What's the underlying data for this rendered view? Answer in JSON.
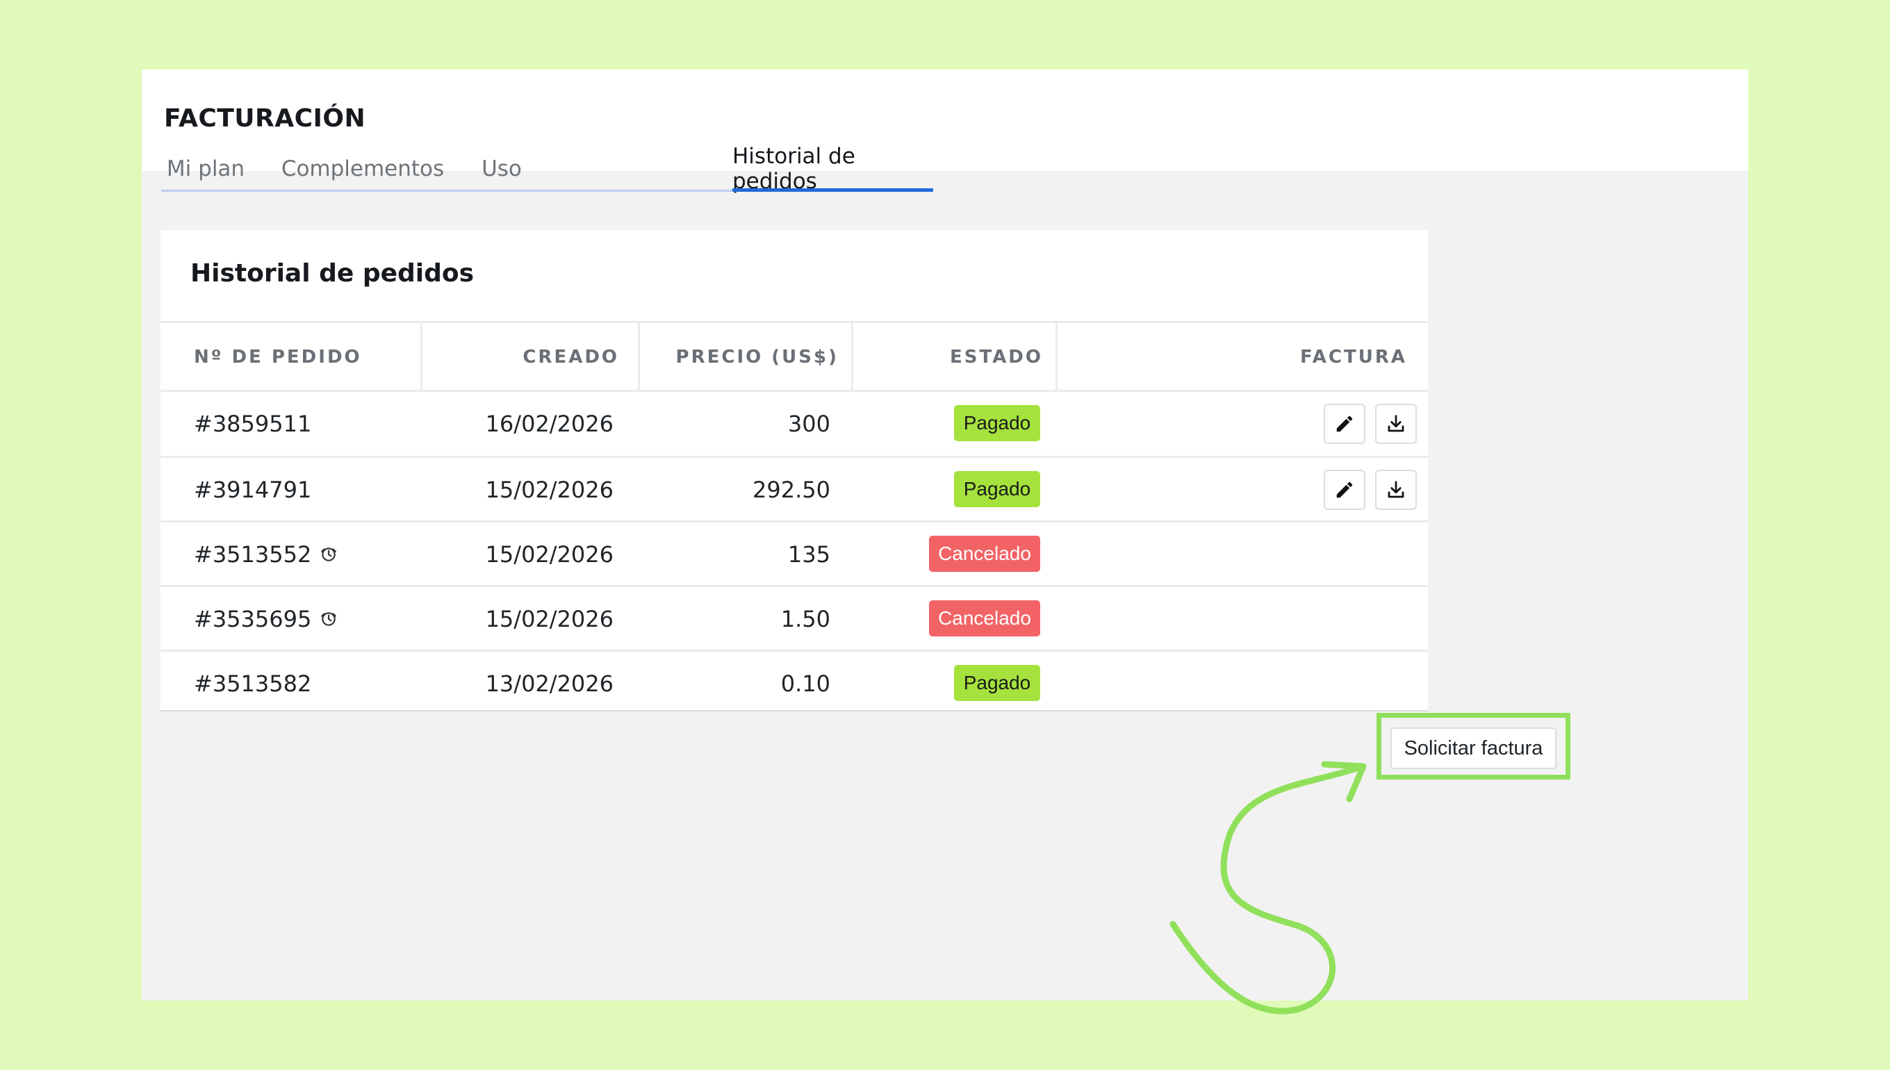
{
  "page": {
    "title": "FACTURACIÓN",
    "tabs": [
      {
        "label": "Mi plan",
        "active": false
      },
      {
        "label": "Complementos",
        "active": false
      },
      {
        "label": "Uso",
        "active": false
      },
      {
        "label": "Historial de pedidos",
        "active": true
      }
    ]
  },
  "orders": {
    "title": "Historial de pedidos",
    "columns": {
      "order": "Nº DE PEDIDO",
      "created": "CREADO",
      "price": "PRECIO (US$)",
      "status": "ESTADO",
      "invoice": "FACTURA"
    },
    "rows": [
      {
        "id": "#3859511",
        "created": "16/02/2026",
        "price": "300",
        "status": "Pagado",
        "status_type": "paid",
        "clock_icon": false,
        "invoice_actions": [
          "edit-icon",
          "download-icon"
        ]
      },
      {
        "id": "#3914791",
        "created": "15/02/2026",
        "price": "292.50",
        "status": "Pagado",
        "status_type": "paid",
        "clock_icon": false,
        "invoice_actions": [
          "edit-icon",
          "download-icon"
        ]
      },
      {
        "id": "#3513552",
        "created": "15/02/2026",
        "price": "135",
        "status": "Cancelado",
        "status_type": "cancelled",
        "clock_icon": true,
        "invoice_actions": []
      },
      {
        "id": "#3535695",
        "created": "15/02/2026",
        "price": "1.50",
        "status": "Cancelado",
        "status_type": "cancelled",
        "clock_icon": true,
        "invoice_actions": []
      },
      {
        "id": "#3513582",
        "created": "13/02/2026",
        "price": "0.10",
        "status": "Pagado",
        "status_type": "paid",
        "clock_icon": false,
        "invoice_actions": [
          "request-invoice"
        ]
      }
    ],
    "request_invoice_label": "Solicitar factura"
  },
  "colors": {
    "background": "#e0fab9",
    "paid": "#a5e23d",
    "cancelled": "#f26366",
    "active_tab": "#1e6ad8",
    "highlight": "#90e05b"
  }
}
